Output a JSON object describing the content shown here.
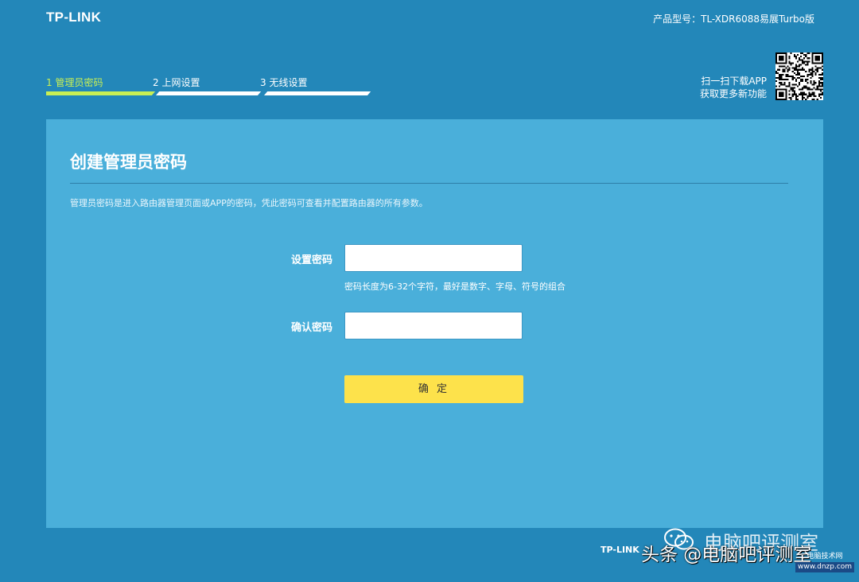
{
  "header": {
    "brand": "TP-LINK",
    "model": "产品型号：TL-XDR6088易展Turbo版"
  },
  "steps": [
    {
      "label": "1 管理员密码",
      "active": true
    },
    {
      "label": "2 上网设置",
      "active": false
    },
    {
      "label": "3 无线设置",
      "active": false
    }
  ],
  "app": {
    "line1": "扫一扫下载APP",
    "line2": "获取更多新功能"
  },
  "form": {
    "title": "创建管理员密码",
    "description": "管理员密码是进入路由器管理页面或APP的密码，凭此密码可查看并配置路由器的所有参数。",
    "password_label": "设置密码",
    "password_value": "",
    "password_hint": "密码长度为6-32个字符，最好是数字、字母、符号的组合",
    "confirm_label": "确认密码",
    "confirm_value": "",
    "submit_label": "确 定"
  },
  "footer": {
    "text": "TP-LINK"
  },
  "watermark": {
    "channel": "电脑吧评测室",
    "main": "头条 @电脑吧评测室",
    "site_name": "电脑技术网",
    "site_url": "www.dnzp.com"
  },
  "colors": {
    "background": "#2387b9",
    "panel": "#4aafda",
    "active_step": "#c8ef54",
    "button": "#fde24b"
  }
}
